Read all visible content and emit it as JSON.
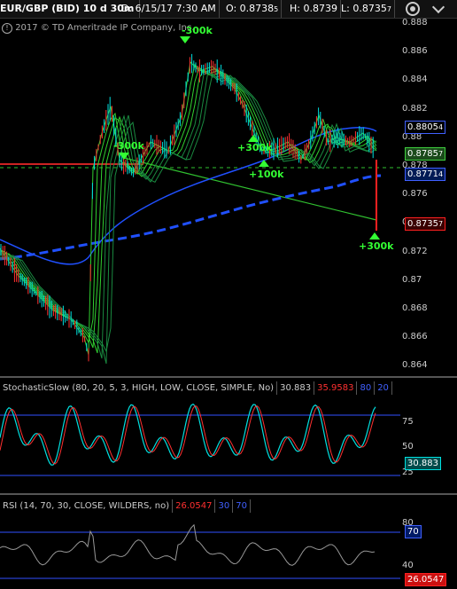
{
  "header": {
    "symbol": "EUR/GBP (BID) 10 d 30m",
    "date": "D: 6/15/17 7:30 AM",
    "open": "O: 0.8738",
    "open_sub": "5",
    "high": "H: 0.8739",
    "low": "L: 0.8735",
    "low_sub": "7"
  },
  "copyright": "2017 © TD Ameritrade IP Company, Inc.",
  "price_axis": [
    "0.888",
    "0.886",
    "0.884",
    "0.882",
    "0.88",
    "0.878",
    "0.876",
    "0.874",
    "0.872",
    "0.87",
    "0.868",
    "0.866",
    "0.864"
  ],
  "price_tags": [
    {
      "value": "0.8805",
      "sub": "4",
      "color": "#4060ff"
    },
    {
      "value": "0.8785",
      "sub": "7",
      "color": "#3fcf3f"
    },
    {
      "value": "0.8771",
      "sub": "4",
      "color": "#4060ff"
    },
    {
      "value": "0.8735",
      "sub": "7",
      "color": "#ff2020"
    }
  ],
  "annotations": [
    "-300k",
    "-300k",
    "+300k",
    "+100k",
    "+300k"
  ],
  "stoch": {
    "title": "StochasticSlow (80, 20, 5, 3, HIGH, LOW, CLOSE, SIMPLE, No)",
    "k": "30.883",
    "d": "35.9583",
    "ob": "80",
    "os": "20",
    "axis": [
      "75",
      "50",
      "25"
    ],
    "tag": "30.883"
  },
  "rsi": {
    "title": "RSI (14, 70, 30, CLOSE, WILDERS, no)",
    "value": "26.0547",
    "os": "30",
    "ob": "70",
    "axis": [
      "80",
      "40"
    ],
    "tag_ob": "70",
    "tag": "26.0547"
  },
  "colors": {
    "up": "#00e0e0",
    "down": "#ff3030",
    "ema": "#30d030",
    "sma": "#2050ff",
    "support": "#cc2222"
  }
}
